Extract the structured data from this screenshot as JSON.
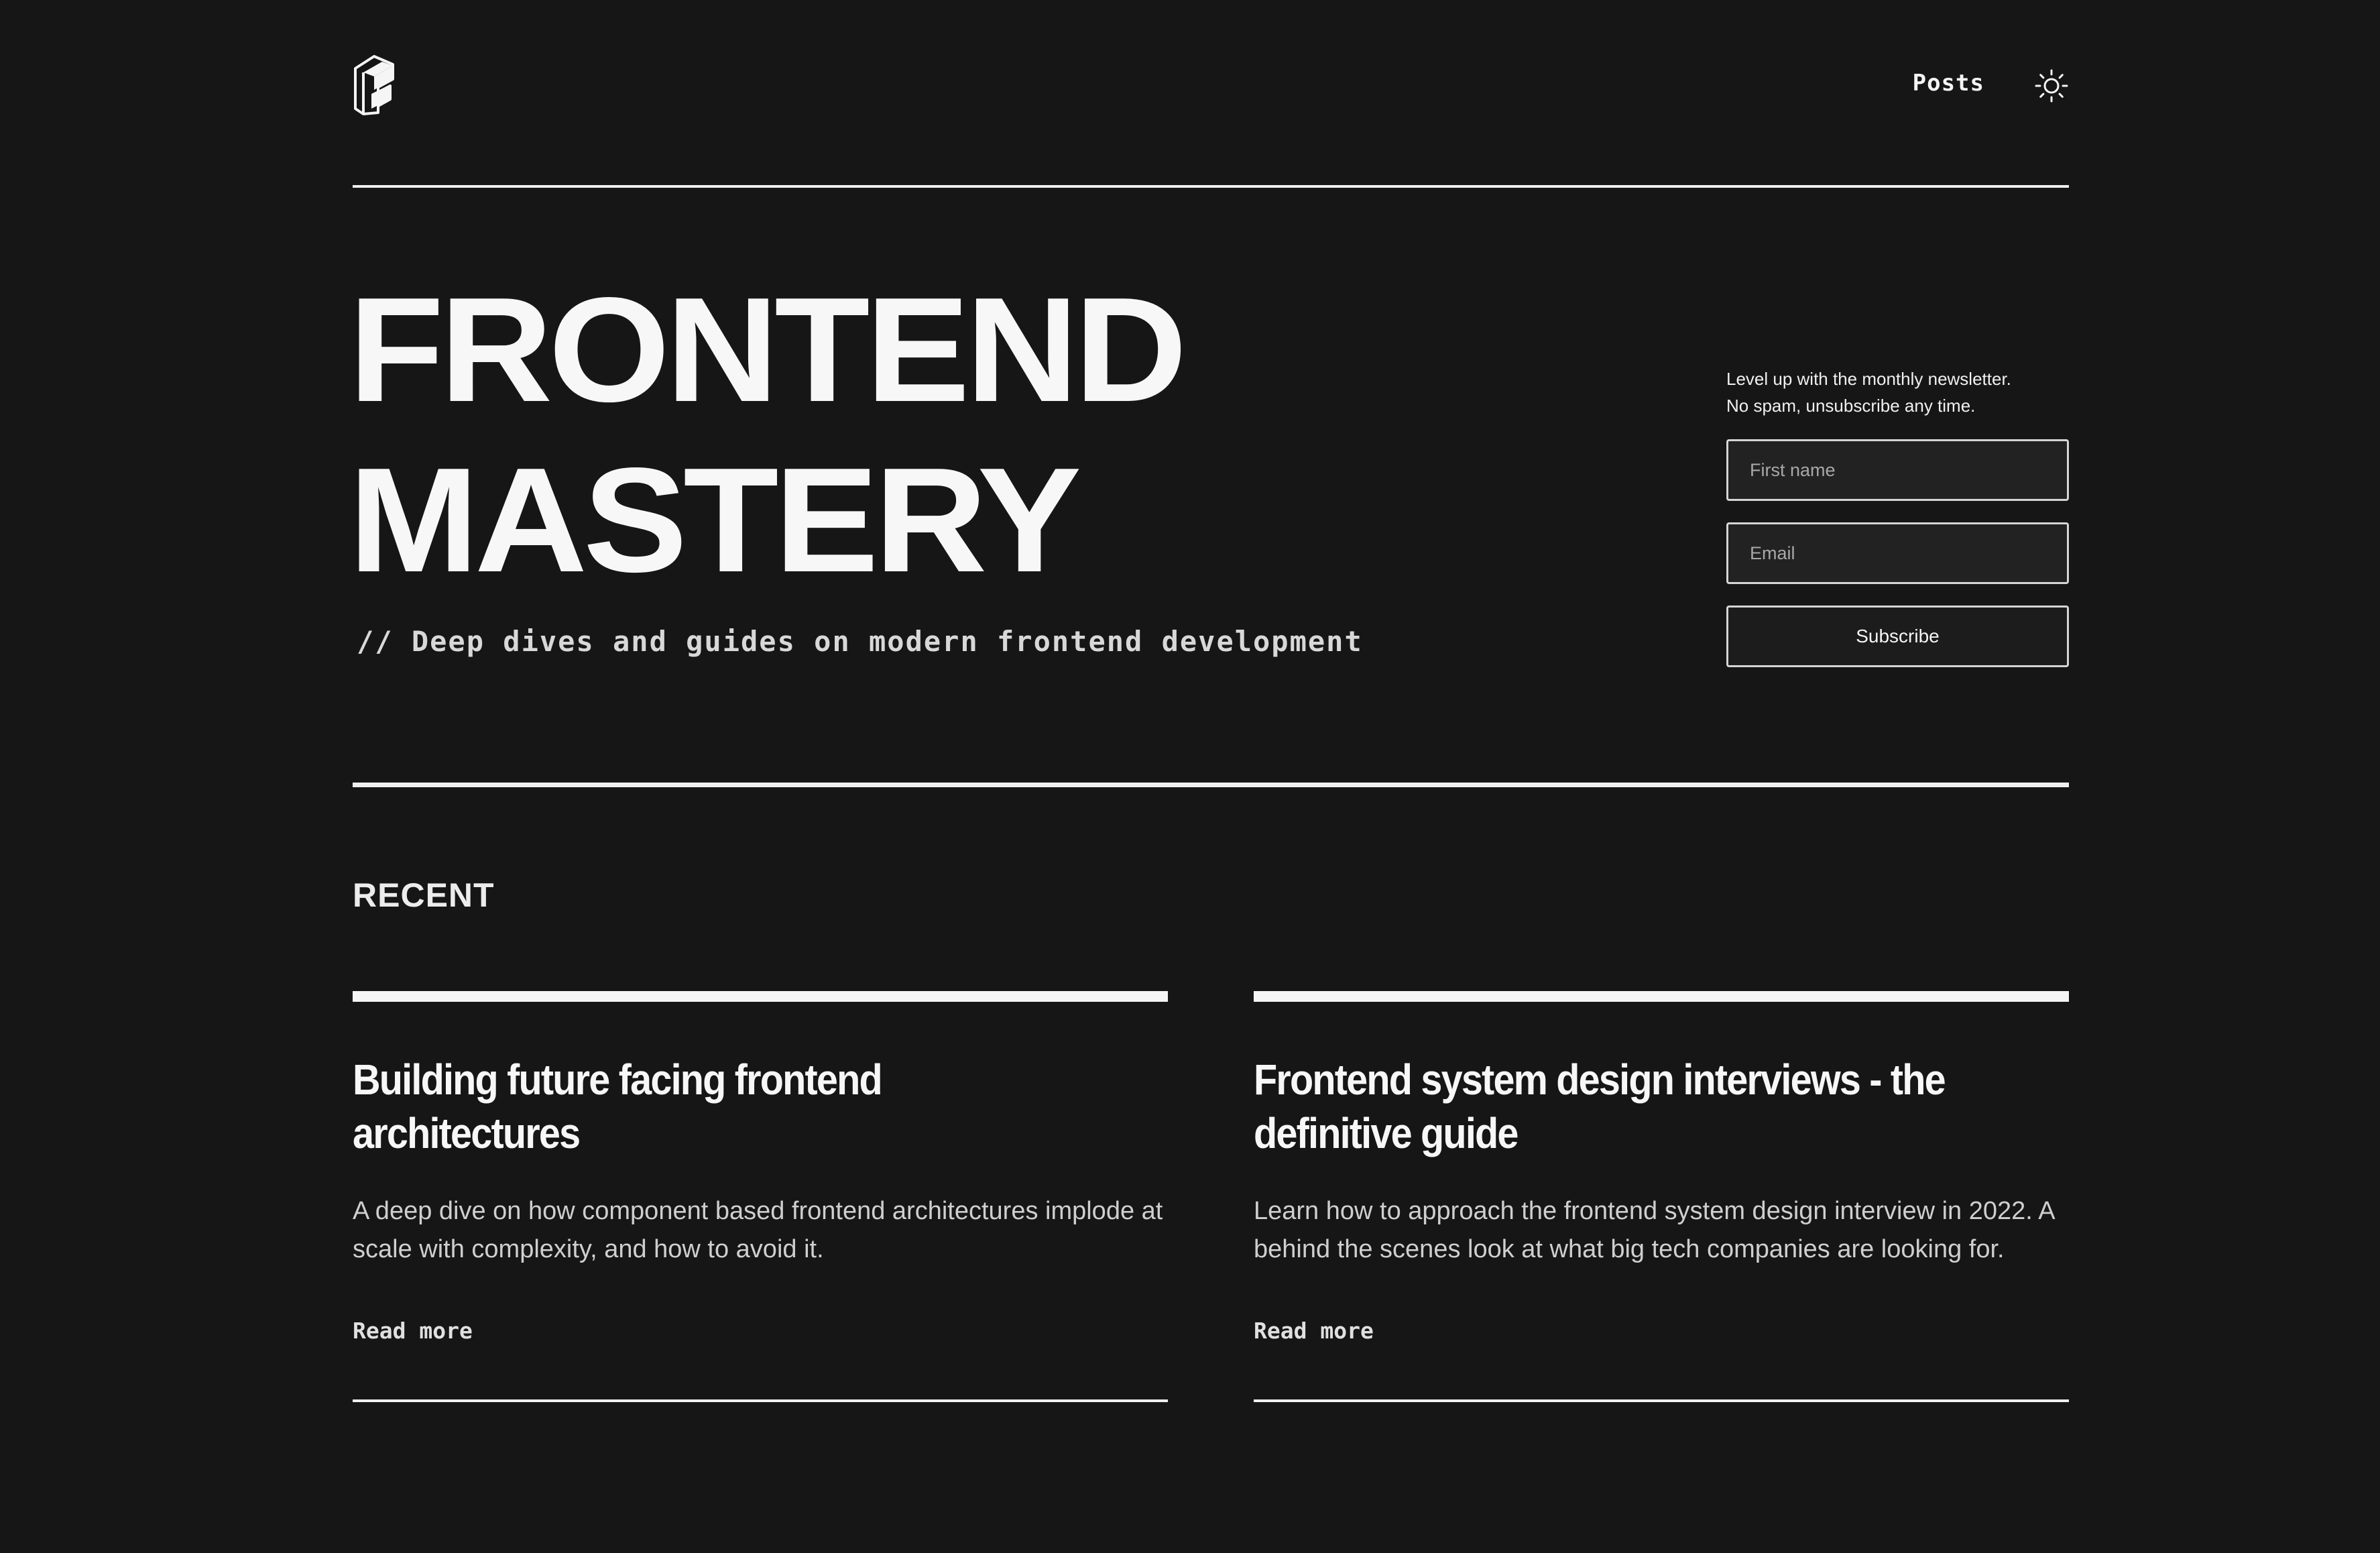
{
  "nav": {
    "logo_icon": "brand-logo-icon",
    "posts_label": "Posts",
    "theme_icon": "sun-icon"
  },
  "hero": {
    "title_line1": "FRONTEND",
    "title_line2": "MASTERY",
    "subtitle": "// Deep dives and guides on modern frontend development"
  },
  "newsletter": {
    "line1": "Level up with the monthly newsletter.",
    "line2": "No spam, unsubscribe any time.",
    "first_name_placeholder": "First name",
    "email_placeholder": "Email",
    "subscribe_label": "Subscribe"
  },
  "recent": {
    "heading": "RECENT",
    "posts": [
      {
        "title": "Building future facing frontend architectures",
        "description": "A deep dive on how component based frontend architectures implode at scale with complexity, and how to avoid it.",
        "link_label": "Read more"
      },
      {
        "title": "Frontend system design interviews - the definitive guide",
        "description": "Learn how to approach the frontend system design interview in 2022. A behind the scenes look at what big tech companies are looking for.",
        "link_label": "Read more"
      }
    ]
  },
  "colors": {
    "background": "#161616",
    "foreground": "#f5f5f5",
    "muted": "#cfcfcf",
    "input_bg": "#222222"
  }
}
